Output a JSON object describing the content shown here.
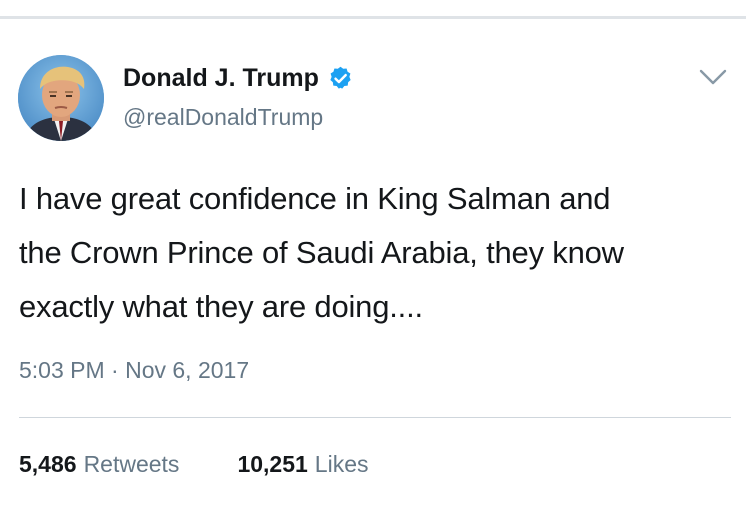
{
  "tweet": {
    "author": {
      "display_name": "Donald J. Trump",
      "handle": "@realDonaldTrump",
      "verified": true,
      "avatar_icon": "profile-photo"
    },
    "text_lines": [
      "I have great confidence in King Salman and",
      "the Crown Prince of Saudi Arabia, they know",
      "exactly what they are doing...."
    ],
    "timestamp": "5:03 PM · Nov 6, 2017",
    "stats": {
      "retweets_count": "5,486",
      "retweets_label": "Retweets",
      "likes_count": "10,251",
      "likes_label": "Likes"
    },
    "menu_icon": "chevron-down-icon"
  },
  "colors": {
    "verified_blue": "#1da1f2",
    "secondary_text": "#657786",
    "primary_text": "#14171a",
    "divider": "#dfe3e7"
  }
}
